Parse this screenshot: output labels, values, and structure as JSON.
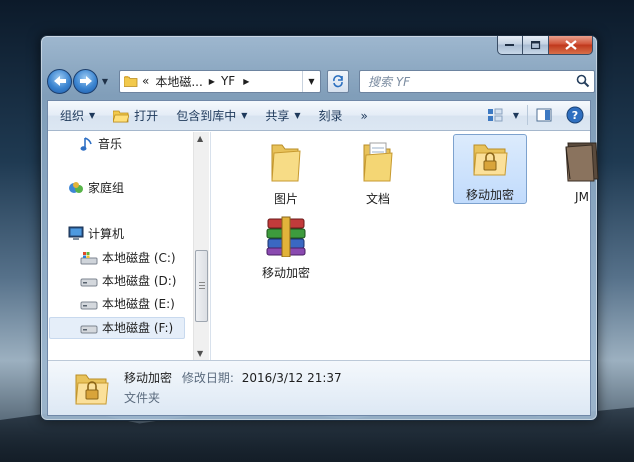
{
  "address": {
    "overflow": "«",
    "crumbs": [
      "本地磁...",
      "YF"
    ]
  },
  "search": {
    "placeholder": "搜索 YF"
  },
  "toolbar": {
    "organize": "组织",
    "open": "打开",
    "include_in_library": "包含到库中",
    "share": "共享",
    "burn": "刻录",
    "more": "»"
  },
  "nav": {
    "music": "音乐",
    "homegroup": "家庭组",
    "computer": "计算机",
    "drives": [
      "本地磁盘 (C:)",
      "本地磁盘 (D:)",
      "本地磁盘 (E:)",
      "本地磁盘 (F:)"
    ]
  },
  "files": [
    {
      "name": "图片",
      "icon": "folder-icon"
    },
    {
      "name": "文档",
      "icon": "folder-documents-icon"
    },
    {
      "name": "移动加密",
      "icon": "locked-folder-icon",
      "selected": true
    },
    {
      "name": "JM",
      "icon": "dark-folder-icon"
    },
    {
      "name": "移动加密",
      "icon": "winrar-archive-icon"
    }
  ],
  "details": {
    "name": "移动加密",
    "modified_label": "修改日期:",
    "modified_value": "2016/3/12 21:37",
    "type": "文件夹"
  }
}
